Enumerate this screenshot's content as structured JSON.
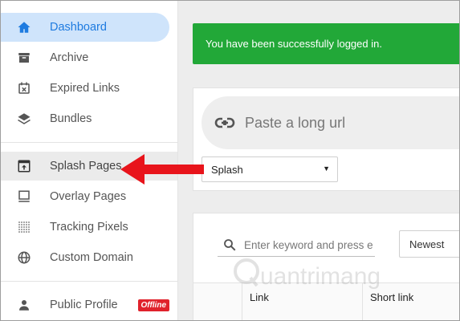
{
  "sidebar": {
    "items": [
      {
        "label": "Dashboard",
        "icon": "home-icon",
        "active": true
      },
      {
        "label": "Archive",
        "icon": "archive-icon"
      },
      {
        "label": "Expired Links",
        "icon": "calendar-x-icon"
      },
      {
        "label": "Bundles",
        "icon": "layers-icon"
      },
      {
        "label": "Splash Pages",
        "icon": "splash-window-icon",
        "highlighted": true
      },
      {
        "label": "Overlay Pages",
        "icon": "monitor-icon"
      },
      {
        "label": "Tracking Pixels",
        "icon": "pixels-grid-icon"
      },
      {
        "label": "Custom Domain",
        "icon": "globe-icon"
      },
      {
        "label": "Public Profile",
        "icon": "person-icon"
      }
    ],
    "public_profile_badge": "Offline"
  },
  "alert": {
    "message": "You have been successfully logged in.",
    "color": "#22a838"
  },
  "shorten": {
    "url_placeholder": "Paste a long url",
    "type_select_value": "Splash"
  },
  "links": {
    "search_placeholder": "Enter keyword and press enter",
    "sort_value": "Newest",
    "columns": [
      "Link",
      "Short link"
    ]
  },
  "watermark": {
    "text": "uantrimang"
  },
  "colors": {
    "accent": "#1e7be0",
    "active_bg": "#cfe4fb",
    "badge": "#e0222c",
    "arrow": "#e8141b"
  }
}
